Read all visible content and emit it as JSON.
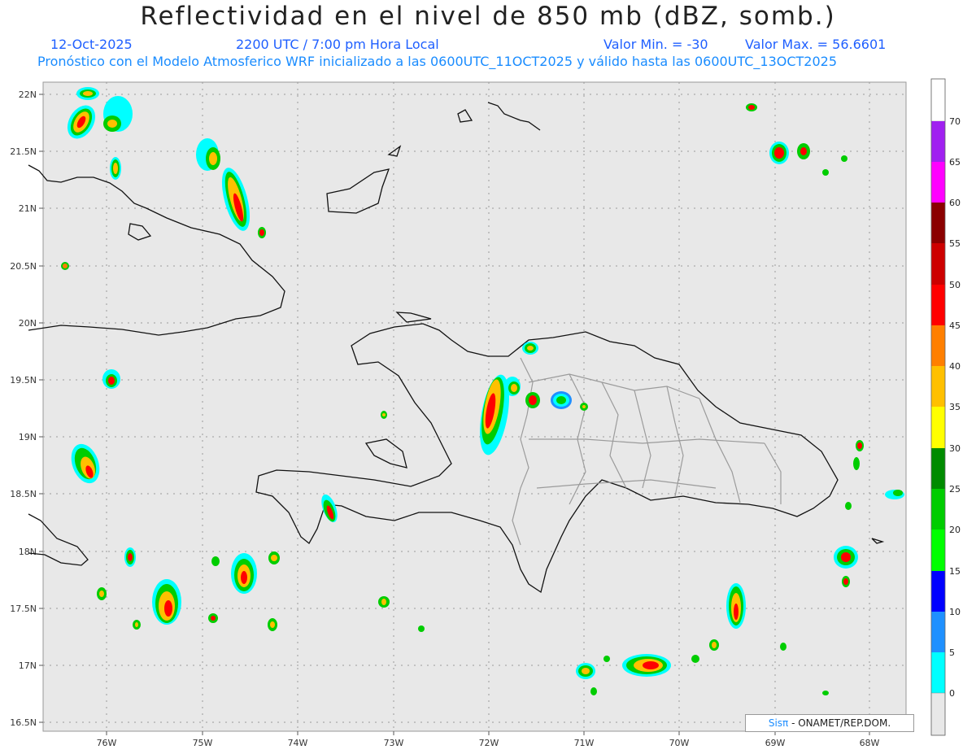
{
  "header": {
    "title": "Reflectividad en el nivel de 850 mb (dBZ, somb.)",
    "date": "12-Oct-2025",
    "time": "2200 UTC / 7:00 pm Hora Local",
    "min_label": "Valor Min. = -30",
    "max_label": "Valor Max. = 56.6601",
    "model_line": "Pronóstico con el Modelo Atmosferico WRF inicializado a las 0600UTC_11OCT2025 y válido hasta las  0600UTC_13OCT2025"
  },
  "axes": {
    "lat_labels": [
      "22N",
      "21.5N",
      "21N",
      "20.5N",
      "20N",
      "19.5N",
      "19N",
      "18.5N",
      "18N",
      "17.5N",
      "17N",
      "16.5N"
    ],
    "lon_labels": [
      "76W",
      "75W",
      "74W",
      "73W",
      "72W",
      "71W",
      "70W",
      "69W",
      "68W"
    ]
  },
  "colorbar": {
    "labels": [
      "70",
      "65",
      "60",
      "55",
      "50",
      "45",
      "40",
      "35",
      "30",
      "25",
      "20",
      "15",
      "10",
      "5",
      "0"
    ],
    "colors": [
      "#ffffff",
      "#a020f0",
      "#ff00ff",
      "#8b0000",
      "#cd0000",
      "#ff0000",
      "#ff7f00",
      "#ffc000",
      "#ffff00",
      "#008b00",
      "#00cd00",
      "#00ff00",
      "#0000ff",
      "#1e90ff",
      "#00ffff",
      "#e8e8e8"
    ]
  },
  "credit": {
    "brand": "Sisπ",
    "text": " - ONAMET/REP.DOM."
  }
}
